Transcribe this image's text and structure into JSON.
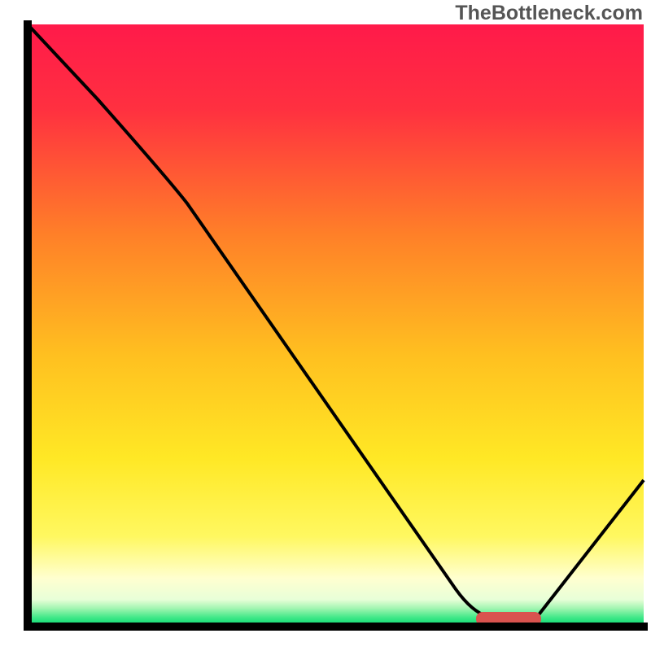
{
  "watermark": "TheBottleneck.com",
  "chart_data": {
    "type": "line",
    "title": "",
    "xlabel": "",
    "ylabel": "",
    "xlim": [
      0,
      100
    ],
    "ylim": [
      0,
      100
    ],
    "background_gradient": {
      "top_color": "#ff1a4a",
      "mid_color": "#ffd700",
      "bottom_strip_color": "#00e676",
      "pale_yellow": "#ffffcc"
    },
    "curve": {
      "description": "Bottleneck curve showing performance mismatch",
      "points": [
        {
          "x": 5,
          "y": 100
        },
        {
          "x": 24,
          "y": 77
        },
        {
          "x": 72,
          "y": 3
        },
        {
          "x": 75,
          "y": 1.5
        },
        {
          "x": 82,
          "y": 1.5
        },
        {
          "x": 100,
          "y": 24
        }
      ]
    },
    "optimal_marker": {
      "x_start": 73,
      "x_end": 83,
      "y": 1.5,
      "color": "#d9534f"
    },
    "axes": {
      "color": "#000000",
      "width": 5
    }
  }
}
